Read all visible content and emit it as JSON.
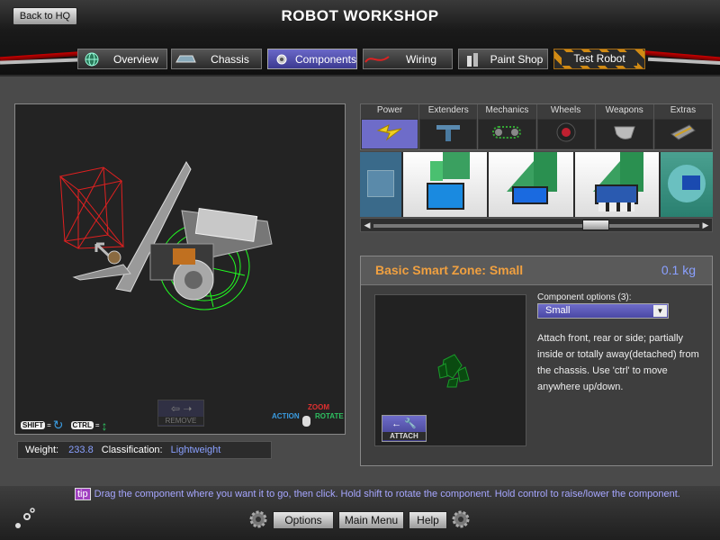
{
  "header": {
    "title": "ROBOT WORKSHOP",
    "back_label": "Back to HQ"
  },
  "nav": {
    "tabs": [
      {
        "label": "Overview",
        "icon": "globe-icon"
      },
      {
        "label": "Chassis",
        "icon": "chassis-icon"
      },
      {
        "label": "Components",
        "icon": "gear-icon",
        "active": true
      },
      {
        "label": "Wiring",
        "icon": "wire-icon"
      },
      {
        "label": "Paint Shop",
        "icon": "paint-icon"
      },
      {
        "label": "Test Robot",
        "icon": ""
      }
    ]
  },
  "viewport": {
    "remove_label": "REMOVE",
    "shift_label": "SHIFT",
    "ctrl_label": "CTRL",
    "equals": "=",
    "action_label": "ACTION",
    "zoom_label": "ZOOM",
    "rotate_label": "ROTATE"
  },
  "stats": {
    "weight_label": "Weight:",
    "weight_value": "233.8",
    "class_label": "Classification:",
    "class_value": "Lightweight"
  },
  "categories": [
    {
      "label": "Power",
      "icon": "lightning-icon",
      "active": true
    },
    {
      "label": "Extenders",
      "icon": "extender-icon"
    },
    {
      "label": "Mechanics",
      "icon": "chain-icon"
    },
    {
      "label": "Wheels",
      "icon": "wheel-icon"
    },
    {
      "label": "Weapons",
      "icon": "blade-icon"
    },
    {
      "label": "Extras",
      "icon": "extras-icon"
    }
  ],
  "component": {
    "name": "Basic Smart Zone: Small",
    "weight": "0.1 kg",
    "options_label": "Component options (3):",
    "selected_option": "Small",
    "description": "Attach front, rear or side; partially inside or totally away(detached) from the chassis. Use 'ctrl' to move anywhere up/down.",
    "attach_label": "ATTACH"
  },
  "footer": {
    "tip_badge": "tip",
    "tip_text": "Drag the component where you want it to go, then click. Hold shift to rotate the component. Hold control to raise/lower the component.",
    "options_label": "Options",
    "main_menu_label": "Main Menu",
    "help_label": "Help"
  },
  "colors": {
    "accent": "#6e6cc9",
    "name_orange": "#f0a040",
    "value_blue": "#8aa0ff"
  }
}
